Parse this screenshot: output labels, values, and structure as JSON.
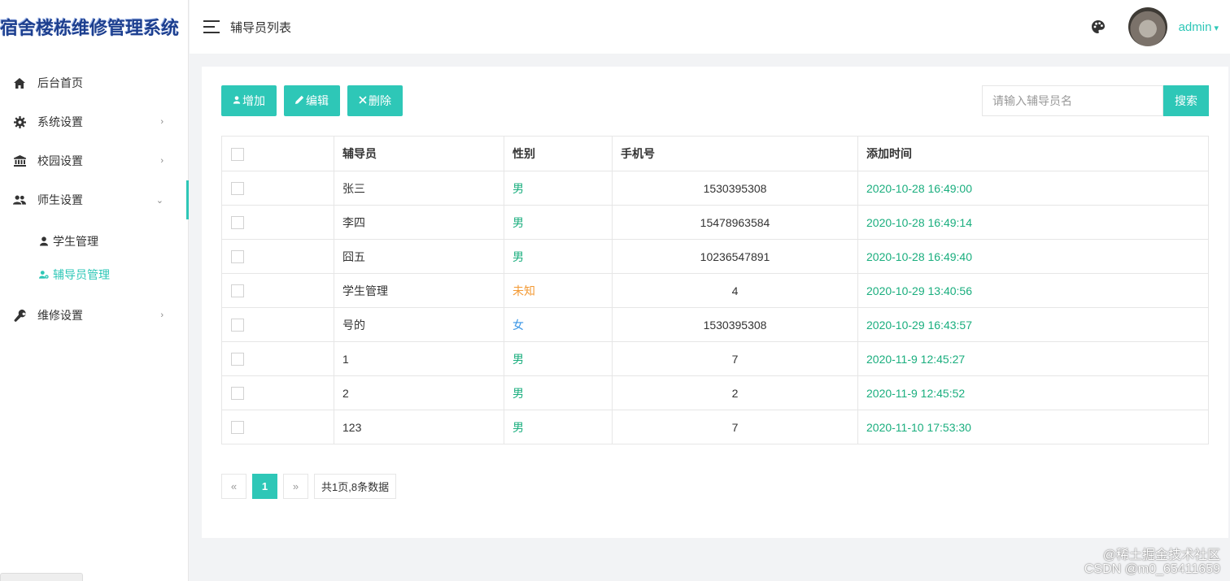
{
  "app": {
    "title": "宿舍楼栋维修管理系统"
  },
  "sidebar": {
    "items": [
      {
        "label": "后台首页"
      },
      {
        "label": "系统设置"
      },
      {
        "label": "校园设置"
      },
      {
        "label": "师生设置"
      },
      {
        "label": "维修设置"
      }
    ],
    "subitems": [
      {
        "label": "学生管理"
      },
      {
        "label": "辅导员管理"
      }
    ]
  },
  "header": {
    "page_title": "辅导员列表",
    "user": "admin"
  },
  "toolbar": {
    "add_label": "增加",
    "edit_label": "编辑",
    "delete_label": "删除"
  },
  "search": {
    "placeholder": "请输入辅导员名",
    "button_label": "搜索"
  },
  "table": {
    "columns": [
      "辅导员",
      "性别",
      "手机号",
      "添加时间"
    ],
    "rows": [
      {
        "name": "张三",
        "gender": "男",
        "phone": "1530395308",
        "time": "2020-10-28 16:49:00"
      },
      {
        "name": "李四",
        "gender": "男",
        "phone": "15478963584",
        "time": "2020-10-28 16:49:14"
      },
      {
        "name": "囧五",
        "gender": "男",
        "phone": "10236547891",
        "time": "2020-10-28 16:49:40"
      },
      {
        "name": "学生管理",
        "gender": "未知",
        "phone": "4",
        "time": "2020-10-29 13:40:56"
      },
      {
        "name": "号的",
        "gender": "女",
        "phone": "1530395308",
        "time": "2020-10-29 16:43:57"
      },
      {
        "name": "1",
        "gender": "男",
        "phone": "7",
        "time": "2020-11-9 12:45:27"
      },
      {
        "name": "2",
        "gender": "男",
        "phone": "2",
        "time": "2020-11-9 12:45:52"
      },
      {
        "name": "123",
        "gender": "男",
        "phone": "7",
        "time": "2020-11-10 17:53:30"
      }
    ]
  },
  "pagination": {
    "prev": "«",
    "current": "1",
    "next": "»",
    "info": "共1页,8条数据"
  },
  "watermark": {
    "line1": "@稀土掘金技术社区",
    "line2": "CSDN @m0_65411659"
  },
  "colors": {
    "accent": "#2ec7b7",
    "male": "#1aae7e",
    "unknown": "#f39a35",
    "female": "#3a96e6"
  }
}
